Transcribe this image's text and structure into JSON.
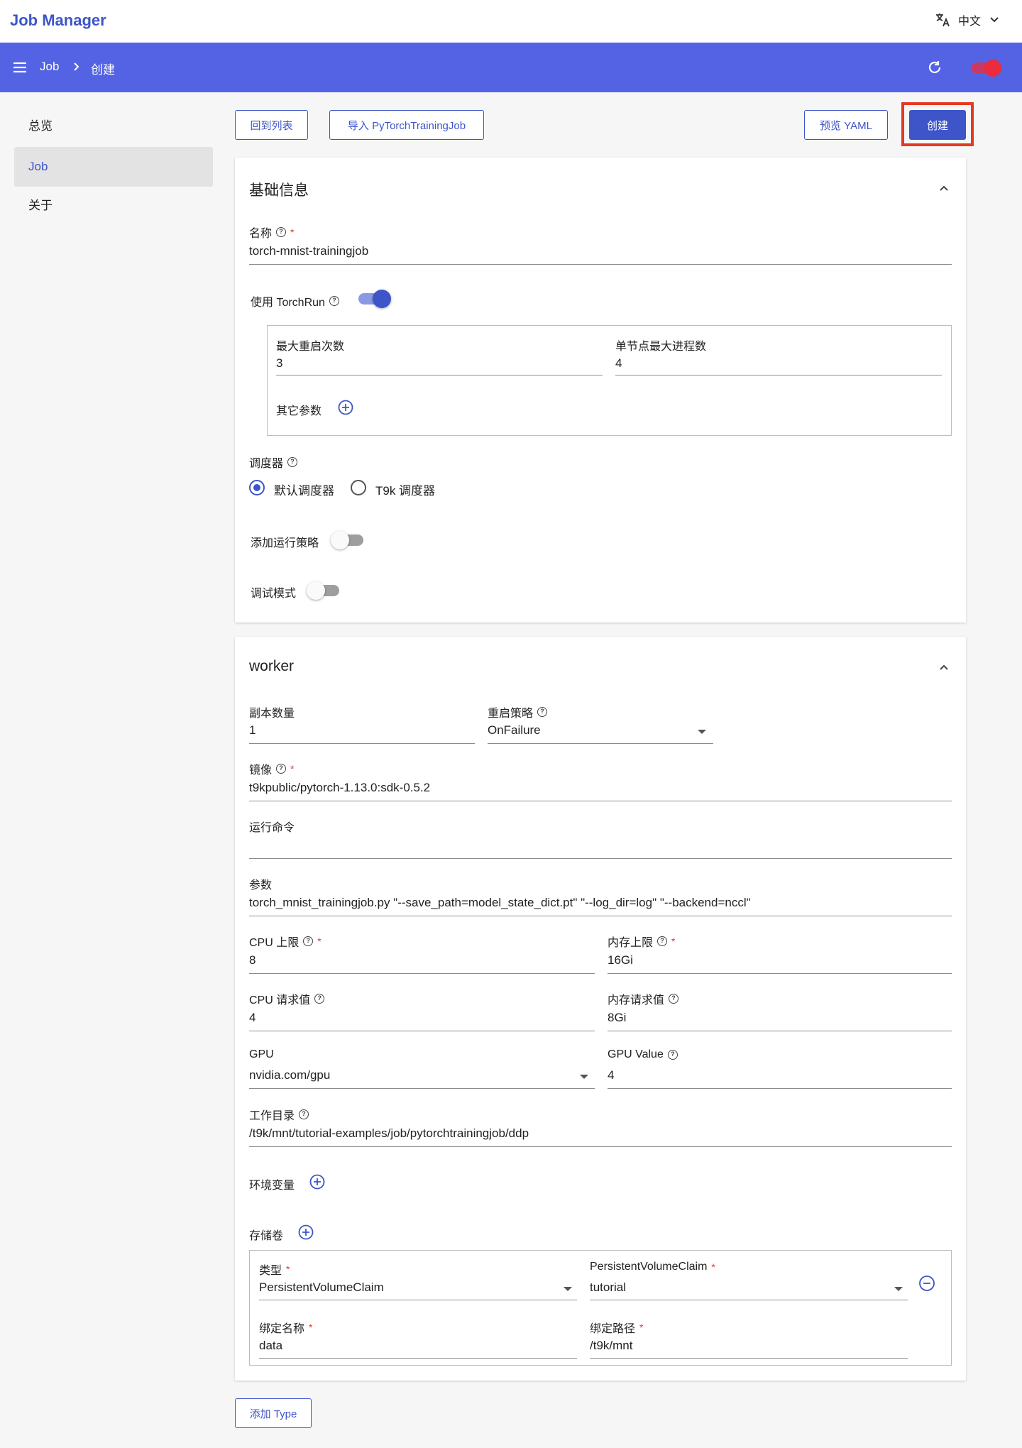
{
  "app": {
    "title": "Job Manager"
  },
  "topbar": {
    "language": "中文"
  },
  "navbar": {
    "breadcrumb": [
      "Job",
      "创建"
    ]
  },
  "sidebar": {
    "items": [
      {
        "label": "总览",
        "active": false
      },
      {
        "label": "Job",
        "active": true
      },
      {
        "label": "关于",
        "active": false
      }
    ]
  },
  "actions": {
    "back": "回到列表",
    "import": "导入 PyTorchTrainingJob",
    "preview": "预览 YAML",
    "create": "创建"
  },
  "basic": {
    "title": "基础信息",
    "name_label": "名称",
    "name_value": "torch-mnist-trainingjob",
    "torchrun_label": "使用 TorchRun",
    "torchrun_on": true,
    "max_restarts_label": "最大重启次数",
    "max_restarts_value": "3",
    "nproc_label": "单节点最大进程数",
    "nproc_value": "4",
    "other_params_label": "其它参数",
    "scheduler_label": "调度器",
    "scheduler_options": [
      "默认调度器",
      "T9k 调度器"
    ],
    "scheduler_selected": "默认调度器",
    "run_policy_label": "添加运行策略",
    "debug_label": "调试模式"
  },
  "worker": {
    "title": "worker",
    "replicas_label": "副本数量",
    "replicas_value": "1",
    "restart_label": "重启策略",
    "restart_value": "OnFailure",
    "image_label": "镜像",
    "image_value": "t9kpublic/pytorch-1.13.0:sdk-0.5.2",
    "command_label": "运行命令",
    "command_value": "",
    "args_label": "参数",
    "args_value": "torch_mnist_trainingjob.py \"--save_path=model_state_dict.pt\" \"--log_dir=log\" \"--backend=nccl\"",
    "cpu_limit_label": "CPU 上限",
    "cpu_limit_value": "8",
    "mem_limit_label": "内存上限",
    "mem_limit_value": "16Gi",
    "cpu_req_label": "CPU 请求值",
    "cpu_req_value": "4",
    "mem_req_label": "内存请求值",
    "mem_req_value": "8Gi",
    "gpu_label": "GPU",
    "gpu_value": "nvidia.com/gpu",
    "gpu_count_label": "GPU Value",
    "gpu_count_value": "4",
    "workdir_label": "工作目录",
    "workdir_value": "/t9k/mnt/tutorial-examples/job/pytorchtrainingjob/ddp",
    "env_label": "环境变量",
    "volumes_label": "存储卷",
    "volume": {
      "type_label": "类型",
      "type_value": "PersistentVolumeClaim",
      "pvc_label": "PersistentVolumeClaim",
      "pvc_value": "tutorial",
      "mount_name_label": "绑定名称",
      "mount_name_value": "data",
      "mount_path_label": "绑定路径",
      "mount_path_value": "/t9k/mnt"
    }
  },
  "add_type": "添加 Type",
  "colors": {
    "primary": "#3d55c9",
    "navbar": "#5463e4",
    "highlight": "#e53923",
    "required": "#e53935"
  }
}
